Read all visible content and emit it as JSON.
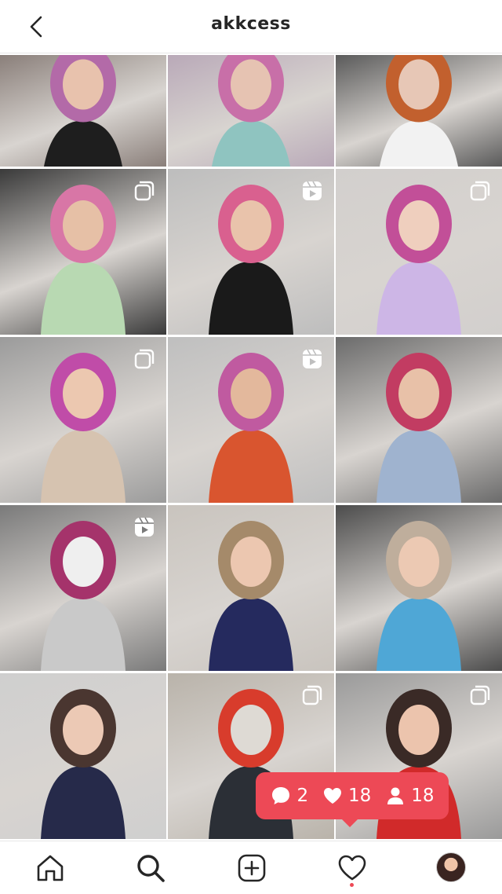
{
  "header": {
    "title": "akkcess",
    "back_icon": "chevron-left-icon"
  },
  "grid": {
    "tiles": [
      {
        "bg": "#8a7f7a",
        "accent": "#b36aa8",
        "skin": "#e8c2ad",
        "cloth": "#1e1e1e",
        "badge": "none"
      },
      {
        "bg": "#b9a9b8",
        "accent": "#c86fa8",
        "skin": "#e6c3b2",
        "cloth": "#8fc4c0",
        "badge": "none"
      },
      {
        "bg": "#5a5a5a",
        "accent": "#c2602e",
        "skin": "#e7c7b6",
        "cloth": "#f2f2f2",
        "badge": "none"
      },
      {
        "bg": "#3a3a3a",
        "accent": "#d876a6",
        "skin": "#e6c0a6",
        "cloth": "#b8d9b2",
        "badge": "carousel"
      },
      {
        "bg": "#bdbdbd",
        "accent": "#d9608f",
        "skin": "#e9c3ab",
        "cloth": "#1a1a1a",
        "badge": "reel"
      },
      {
        "bg": "#d2cfcd",
        "accent": "#c24f98",
        "skin": "#efcfbe",
        "cloth": "#cdb6e6",
        "badge": "carousel"
      },
      {
        "bg": "#9b9b9b",
        "accent": "#c04ca8",
        "skin": "#ecc8b0",
        "cloth": "#d6c3b0",
        "badge": "carousel"
      },
      {
        "bg": "#bfbfbf",
        "accent": "#c05aa0",
        "skin": "#e3b89c",
        "cloth": "#d9552f",
        "badge": "reel"
      },
      {
        "bg": "#6b6b6b",
        "accent": "#c23c62",
        "skin": "#e8c1a8",
        "cloth": "#9fb3cf",
        "badge": "none"
      },
      {
        "bg": "#7a7a7a",
        "accent": "#a5336b",
        "skin": "#efefef",
        "cloth": "#c9c9c9",
        "badge": "reel"
      },
      {
        "bg": "#c9c4be",
        "accent": "#a58a6a",
        "skin": "#ecc7b0",
        "cloth": "#252a5e",
        "badge": "none"
      },
      {
        "bg": "#4c4c4c",
        "accent": "#bfae9c",
        "skin": "#ecc9b3",
        "cloth": "#4fa7d6",
        "badge": "none"
      },
      {
        "bg": "#cfcfcf",
        "accent": "#4a3630",
        "skin": "#ecc9b5",
        "cloth": "#262a4a",
        "badge": "none"
      },
      {
        "bg": "#b9b3aa",
        "accent": "#d83c2c",
        "skin": "#dedad4",
        "cloth": "#2b2f36",
        "badge": "carousel"
      },
      {
        "bg": "#9a9a9a",
        "accent": "#3a2a26",
        "skin": "#ecc4ad",
        "cloth": "#d12a2a",
        "badge": "carousel"
      }
    ]
  },
  "notification": {
    "comments": "2",
    "likes": "18",
    "follows": "18",
    "color": "#ed4956"
  },
  "bottom_nav": {
    "items": [
      "home-icon",
      "search-icon",
      "add-post-icon",
      "activity-heart-icon",
      "profile-avatar"
    ],
    "active": "search-icon"
  }
}
